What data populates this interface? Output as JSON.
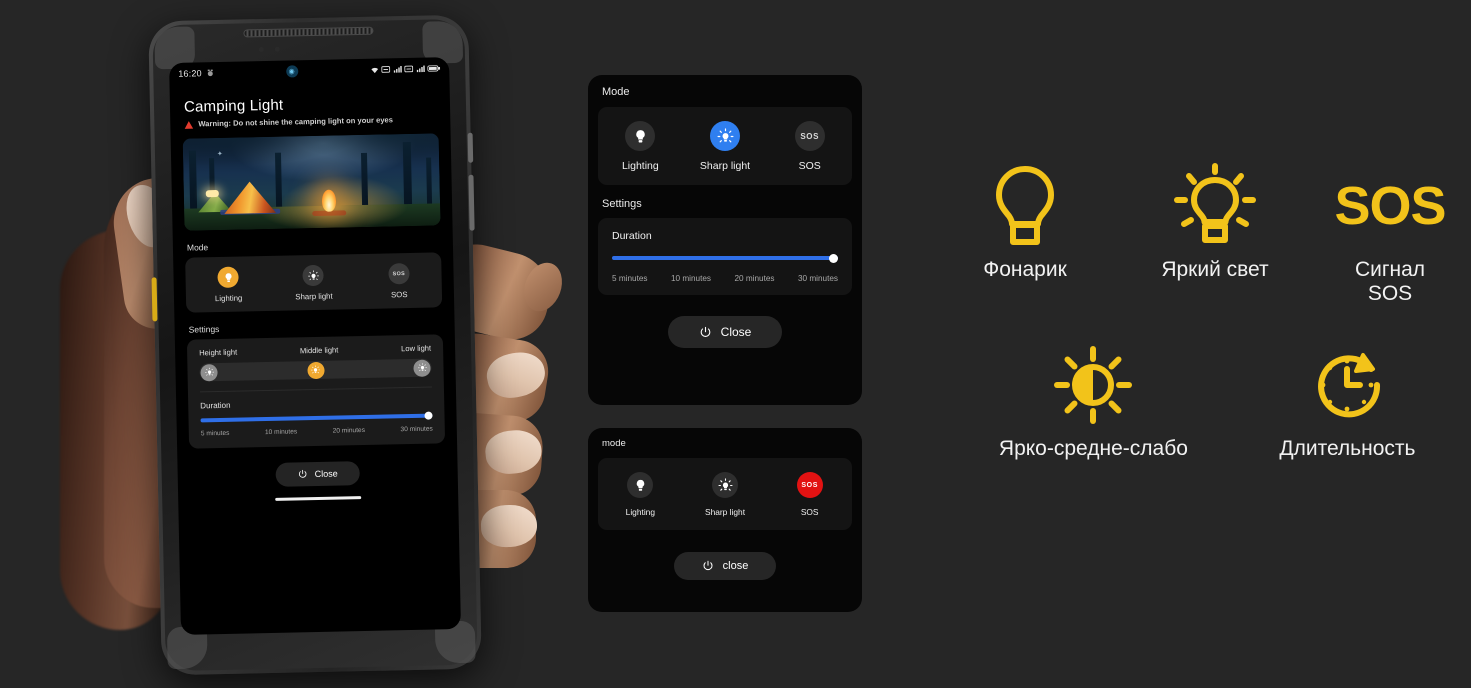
{
  "theme": {
    "page_background": "#262626",
    "accent_amber": "#f0a930",
    "accent_blue": "#2f7ff0",
    "accent_red": "#e21212",
    "legend_yellow": "#f2c31a"
  },
  "phone": {
    "status_bar": {
      "time": "16:20",
      "icons_left": [
        "alarm-icon"
      ],
      "icon_center": "location-pill-icon",
      "icons_right": [
        "wifi-icon",
        "sim1-icon",
        "signal1-icon",
        "sim2-icon",
        "signal2-icon",
        "battery-icon"
      ]
    },
    "app": {
      "title": "Camping Light",
      "warning": "Warning: Do not shine the camping light on your eyes",
      "hero_alt": "camping tent at night with campfire in forest",
      "mode_section_label": "Mode",
      "modes": [
        {
          "label": "Lighting",
          "icon": "bulb-icon",
          "state": "active-amber"
        },
        {
          "label": "Sharp light",
          "icon": "sharp-light-icon",
          "state": "inactive"
        },
        {
          "label": "SOS",
          "icon": "sos-icon",
          "state": "inactive",
          "glyph": "SOS"
        }
      ],
      "settings_section_label": "Settings",
      "brightness": {
        "levels": [
          "Height light",
          "Middle light",
          "Low light"
        ],
        "selected_index": 1
      },
      "duration": {
        "label": "Duration",
        "ticks": [
          "5 minutes",
          "10 minutes",
          "20 minutes",
          "30 minutes"
        ],
        "fill_percent": 100
      },
      "close_button": {
        "label": "Close",
        "icon": "power-icon"
      }
    }
  },
  "panel_sharp_light": {
    "mode_label": "Mode",
    "modes": [
      {
        "label": "Lighting",
        "icon": "bulb-icon",
        "state": "inactive",
        "glyph": ""
      },
      {
        "label": "Sharp light",
        "icon": "sharp-light-icon",
        "state": "active-blue",
        "glyph": ""
      },
      {
        "label": "SOS",
        "icon": "sos-icon",
        "state": "inactive",
        "glyph": "SOS"
      }
    ],
    "settings_label": "Settings",
    "duration": {
      "label": "Duration",
      "ticks": [
        "5 minutes",
        "10 minutes",
        "20 minutes",
        "30 minutes"
      ],
      "fill_percent": 100
    },
    "close_button": {
      "label": "Close",
      "icon": "power-icon"
    }
  },
  "panel_sos": {
    "mode_label": "mode",
    "modes": [
      {
        "label": "Lighting",
        "icon": "bulb-icon",
        "state": "inactive",
        "glyph": ""
      },
      {
        "label": "Sharp light",
        "icon": "sharp-light-icon",
        "state": "inactive",
        "glyph": ""
      },
      {
        "label": "SOS",
        "icon": "sos-icon",
        "state": "active-red",
        "glyph": "SOS"
      }
    ],
    "close_button": {
      "label": "close",
      "icon": "power-icon"
    }
  },
  "legend": {
    "row1": [
      {
        "icon": "flashlight-bulb-icon",
        "label": "Фонарик"
      },
      {
        "icon": "bright-light-icon",
        "label": "Яркий свет"
      },
      {
        "icon": "sos-text-icon",
        "label": "Сигнал\nSOS",
        "glyph": "SOS"
      }
    ],
    "row2": [
      {
        "icon": "brightness-levels-icon",
        "label": "Ярко-средне-слабо"
      },
      {
        "icon": "duration-clock-icon",
        "label": "Длительность"
      }
    ]
  }
}
